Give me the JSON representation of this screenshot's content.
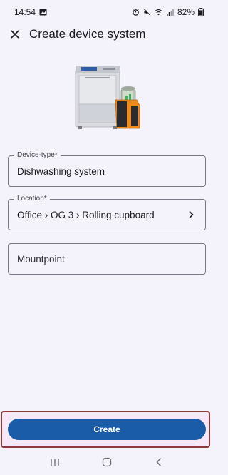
{
  "status_bar": {
    "time": "14:54",
    "battery": "82%"
  },
  "header": {
    "title": "Create device system",
    "close_icon": "close-icon"
  },
  "form": {
    "device_type": {
      "label": "Device-type*",
      "value": "Dishwashing system"
    },
    "location": {
      "label": "Location*",
      "value": "Office › OG 3 › Rolling cupboard"
    },
    "mountpoint": {
      "placeholder": "Mountpoint"
    }
  },
  "actions": {
    "create_label": "Create"
  },
  "colors": {
    "primary": "#1b5ca8",
    "background": "#f4f3fb",
    "highlight_border": "#8c3a3a"
  }
}
